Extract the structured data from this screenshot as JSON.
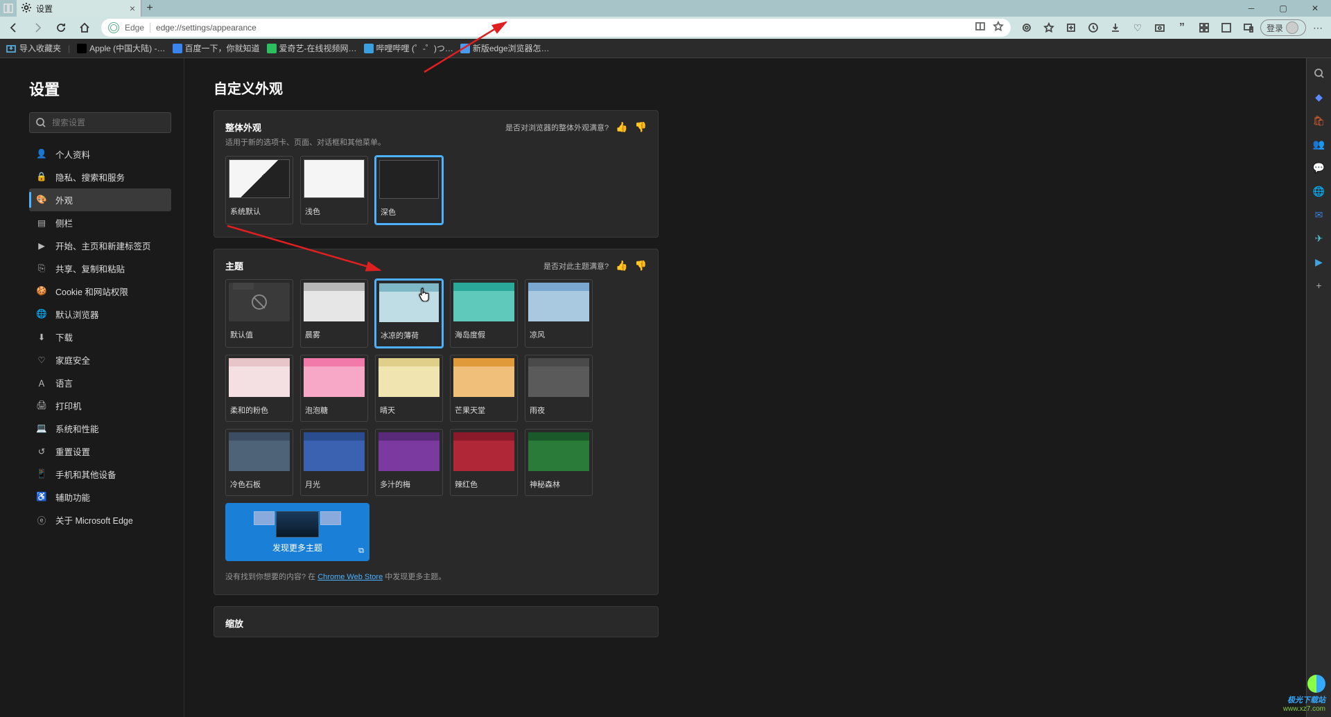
{
  "browser": {
    "tab_title": "设置",
    "address_label": "Edge",
    "url": "edge://settings/appearance",
    "login_label": "登录"
  },
  "bookmarks": {
    "import_label": "导入收藏夹",
    "items": [
      "Apple (中国大陆) -…",
      "百度一下，你就知道",
      "爱奇艺-在线视频网…",
      "哔哩哔哩 (゜-゜)つ…",
      "新版edge浏览器怎…"
    ]
  },
  "sidebar": {
    "title": "设置",
    "search_placeholder": "搜索设置",
    "items": [
      "个人资料",
      "隐私、搜索和服务",
      "外观",
      "侧栏",
      "开始、主页和新建标签页",
      "共享、复制和粘贴",
      "Cookie 和网站权限",
      "默认浏览器",
      "下载",
      "家庭安全",
      "语言",
      "打印机",
      "系统和性能",
      "重置设置",
      "手机和其他设备",
      "辅助功能",
      "关于 Microsoft Edge"
    ],
    "active_index": 2
  },
  "content": {
    "page_title": "自定义外观",
    "overall": {
      "title": "整体外观",
      "sub": "适用于新的选项卡、页面、对话框和其他菜单。",
      "feedback": "是否对浏览器的整体外观满意?",
      "options": [
        "系统默认",
        "浅色",
        "深色"
      ],
      "selected_index": 2
    },
    "theme": {
      "title": "主题",
      "feedback": "是否对此主题满意?",
      "selected_index": 2,
      "items": [
        {
          "label": "默认值",
          "tab": "#444",
          "body": "#3a3a3a",
          "default": true
        },
        {
          "label": "晨雾",
          "tab": "#b8b8b8",
          "body": "#e6e6e6"
        },
        {
          "label": "冰凉的薄荷",
          "tab": "#7eb8c7",
          "body": "#bfdde5"
        },
        {
          "label": "海岛度假",
          "tab": "#2aa89a",
          "body": "#5fc9bb"
        },
        {
          "label": "凉风",
          "tab": "#7ba8d1",
          "body": "#a9c9e0"
        },
        {
          "label": "柔和的粉色",
          "tab": "#e8c5c8",
          "body": "#f4e0e2"
        },
        {
          "label": "泡泡糖",
          "tab": "#f27aaa",
          "body": "#f7a8c6"
        },
        {
          "label": "晴天",
          "tab": "#e0cf8a",
          "body": "#f0e4b0"
        },
        {
          "label": "芒果天堂",
          "tab": "#e09a3a",
          "body": "#f0bf7a"
        },
        {
          "label": "雨夜",
          "tab": "#4a4a4a",
          "body": "#5a5a5a"
        },
        {
          "label": "冷色石板",
          "tab": "#3a4d62",
          "body": "#4f6378"
        },
        {
          "label": "月光",
          "tab": "#2a4d8f",
          "body": "#3a62b0"
        },
        {
          "label": "多汁的梅",
          "tab": "#5a2a7a",
          "body": "#7a3aa0"
        },
        {
          "label": "辣红色",
          "tab": "#8a1a2a",
          "body": "#b02838"
        },
        {
          "label": "神秘森林",
          "tab": "#1a5a2a",
          "body": "#2a7a3a"
        }
      ],
      "discover_label": "发现更多主题",
      "footnote_prefix": "没有找到你想要的内容? 在 ",
      "footnote_link": "Chrome Web Store",
      "footnote_suffix": " 中发现更多主题。"
    },
    "zoom_title": "缩放"
  },
  "watermark": {
    "line1": "极光下载站",
    "line2": "www.xz7.com"
  }
}
